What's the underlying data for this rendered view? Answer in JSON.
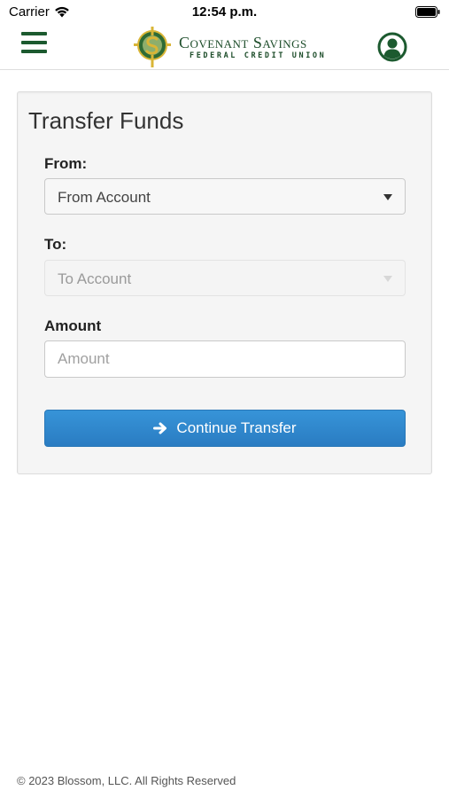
{
  "status_bar": {
    "carrier": "Carrier",
    "time": "12:54 p.m."
  },
  "header": {
    "brand_name": "Covenant Savings",
    "brand_sub": "FEDERAL CREDIT UNION",
    "brand_color": "#1c5a2f"
  },
  "transfer": {
    "title": "Transfer Funds",
    "from_label": "From:",
    "from_value": "From Account",
    "to_label": "To:",
    "to_value": "To Account",
    "amount_label": "Amount",
    "amount_placeholder": "Amount",
    "continue_label": "Continue Transfer",
    "accent_color": "#2f86cc"
  },
  "footer": {
    "copyright": "© 2023 Blossom, LLC. All Rights Reserved"
  }
}
